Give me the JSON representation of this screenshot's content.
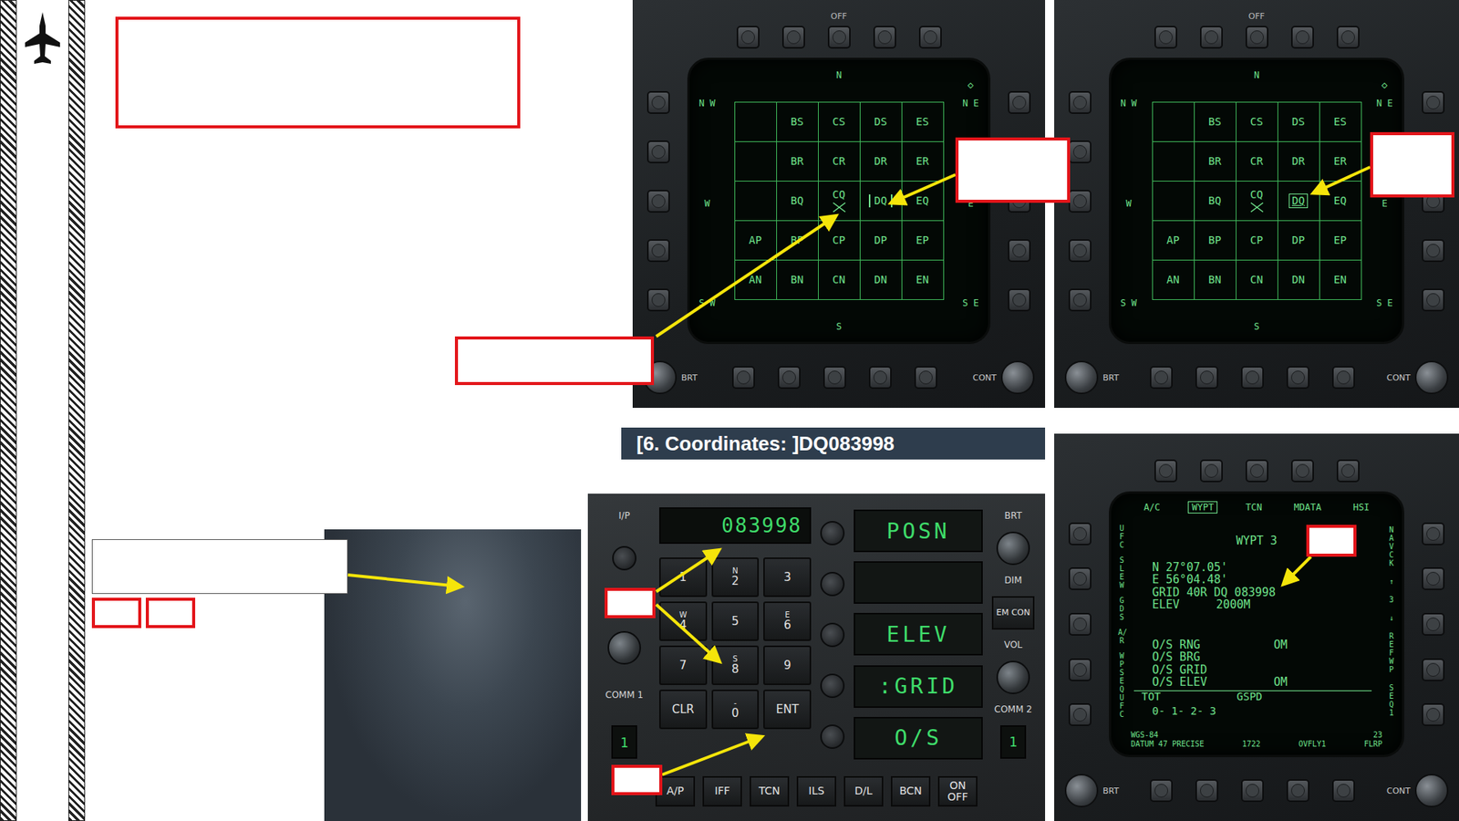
{
  "map_displays": [
    {
      "kind": "bars",
      "top_label": "OFF",
      "knobs": [
        "BRT",
        "CONT"
      ],
      "diamond": "◇",
      "compass": {
        "n": "N",
        "ne": "N E",
        "e": "E",
        "se": "S E",
        "s": "S",
        "sw": "S W",
        "w": "W",
        "nw": "N W"
      },
      "rows": [
        [
          {
            "label": "",
            "selected": false,
            "cursor": false
          },
          {
            "label": "BS",
            "selected": false,
            "cursor": false
          },
          {
            "label": "CS",
            "selected": false,
            "cursor": false
          },
          {
            "label": "DS",
            "selected": false,
            "cursor": false
          },
          {
            "label": "ES",
            "selected": false,
            "cursor": false
          }
        ],
        [
          {
            "label": "",
            "selected": false,
            "cursor": false
          },
          {
            "label": "BR",
            "selected": false,
            "cursor": false
          },
          {
            "label": "CR",
            "selected": false,
            "cursor": false
          },
          {
            "label": "DR",
            "selected": false,
            "cursor": false
          },
          {
            "label": "ER",
            "selected": false,
            "cursor": false
          }
        ],
        [
          {
            "label": "",
            "selected": false,
            "cursor": false
          },
          {
            "label": "BQ",
            "selected": false,
            "cursor": false
          },
          {
            "label": "CQ",
            "selected": false,
            "cursor": true
          },
          {
            "label": "DQ",
            "selected": true,
            "cursor": false
          },
          {
            "label": "EQ",
            "selected": false,
            "cursor": false
          }
        ],
        [
          {
            "label": "AP",
            "selected": false,
            "cursor": false
          },
          {
            "label": "BP",
            "selected": false,
            "cursor": false
          },
          {
            "label": "CP",
            "selected": false,
            "cursor": false
          },
          {
            "label": "DP",
            "selected": false,
            "cursor": false
          },
          {
            "label": "EP",
            "selected": false,
            "cursor": false
          }
        ],
        [
          {
            "label": "AN",
            "selected": false,
            "cursor": false
          },
          {
            "label": "BN",
            "selected": false,
            "cursor": false
          },
          {
            "label": "CN",
            "selected": false,
            "cursor": false
          },
          {
            "label": "DN",
            "selected": false,
            "cursor": false
          },
          {
            "label": "EN",
            "selected": false,
            "cursor": false
          }
        ]
      ]
    },
    {
      "kind": "box",
      "top_label": "OFF",
      "knobs": [
        "BRT",
        "CONT"
      ],
      "diamond": "◇",
      "compass": {
        "n": "N",
        "ne": "N E",
        "e": "E",
        "se": "S E",
        "s": "S",
        "sw": "S W",
        "w": "W",
        "nw": "N W"
      },
      "rows": [
        [
          {
            "label": "",
            "selected": false,
            "cursor": false
          },
          {
            "label": "BS",
            "selected": false,
            "cursor": false
          },
          {
            "label": "CS",
            "selected": false,
            "cursor": false
          },
          {
            "label": "DS",
            "selected": false,
            "cursor": false
          },
          {
            "label": "ES",
            "selected": false,
            "cursor": false
          }
        ],
        [
          {
            "label": "",
            "selected": false,
            "cursor": false
          },
          {
            "label": "BR",
            "selected": false,
            "cursor": false
          },
          {
            "label": "CR",
            "selected": false,
            "cursor": false
          },
          {
            "label": "DR",
            "selected": false,
            "cursor": false
          },
          {
            "label": "ER",
            "selected": false,
            "cursor": false
          }
        ],
        [
          {
            "label": "",
            "selected": false,
            "cursor": false
          },
          {
            "label": "BQ",
            "selected": false,
            "cursor": false
          },
          {
            "label": "CQ",
            "selected": false,
            "cursor": true
          },
          {
            "label": "DQ",
            "selected": true,
            "cursor": false
          },
          {
            "label": "EQ",
            "selected": false,
            "cursor": false
          }
        ],
        [
          {
            "label": "AP",
            "selected": false,
            "cursor": false
          },
          {
            "label": "BP",
            "selected": false,
            "cursor": false
          },
          {
            "label": "CP",
            "selected": false,
            "cursor": false
          },
          {
            "label": "DP",
            "selected": false,
            "cursor": false
          },
          {
            "label": "EP",
            "selected": false,
            "cursor": false
          }
        ],
        [
          {
            "label": "AN",
            "selected": false,
            "cursor": false
          },
          {
            "label": "BN",
            "selected": false,
            "cursor": false
          },
          {
            "label": "CN",
            "selected": false,
            "cursor": false
          },
          {
            "label": "DN",
            "selected": false,
            "cursor": false
          },
          {
            "label": "EN",
            "selected": false,
            "cursor": false
          }
        ]
      ]
    }
  ],
  "caption": "[6. Coordinates: ]DQ083998",
  "ufc": {
    "scratchpad": "083998",
    "keys": [
      {
        "main": "1",
        "sub": ""
      },
      {
        "main": "2",
        "sub": "N"
      },
      {
        "main": "3",
        "sub": ""
      },
      {
        "main": "4",
        "sub": "W"
      },
      {
        "main": "5",
        "sub": ""
      },
      {
        "main": "6",
        "sub": "E"
      },
      {
        "main": "7",
        "sub": ""
      },
      {
        "main": "8",
        "sub": "S"
      },
      {
        "main": "9",
        "sub": ""
      },
      {
        "main": "CLR",
        "sub": ""
      },
      {
        "main": "0",
        "sub": "-"
      },
      {
        "main": "ENT",
        "sub": ""
      }
    ],
    "options": [
      "POSN",
      "",
      "ELEV",
      ":GRID",
      "O/S"
    ],
    "function_keys": [
      "A/P",
      "IFF",
      "TCN",
      "ILS",
      "D/L",
      "BCN",
      "ON OFF"
    ],
    "left": {
      "ip": "I/P",
      "vol": "VOL",
      "comm": "COMM 1",
      "channel": "1"
    },
    "right": {
      "brt": "BRT",
      "dim": "DIM",
      "emcon": "EM CON",
      "vol": "VOL",
      "comm": "COMM 2",
      "channel": "1"
    }
  },
  "waypoint_display": {
    "knobs": [
      "BRT",
      "CONT"
    ],
    "tabs": [
      {
        "label": "A/C",
        "selected": false
      },
      {
        "label": "WYPT",
        "selected": true
      },
      {
        "label": "TCN",
        "selected": false
      },
      {
        "label": "MDATA",
        "selected": false
      },
      {
        "label": "HSI",
        "selected": false
      }
    ],
    "left_options": [
      "UFC",
      "SLEW",
      "GDS",
      "A/R",
      "WP SEQUFC"
    ],
    "right_options": [
      "NAV CK",
      "↑",
      "3",
      "↓",
      "REF WP",
      "SEQ1"
    ],
    "title": "WYPT 3",
    "lat": "N 27°07.05'",
    "lon": "E 56°04.48'",
    "grid": "GRID 40R DQ 083998",
    "elev": "ELEV",
    "elev_value": "2000M",
    "offsets": [
      {
        "label": "O/S RNG",
        "value": "OM"
      },
      {
        "label": "O/S BRG",
        "value": ""
      },
      {
        "label": "O/S GRID",
        "value": ""
      },
      {
        "label": "O/S ELEV",
        "value": "OM"
      }
    ],
    "tot": "TOT",
    "gspd": "GSPD",
    "tot_value": "0- 1- 2- 3",
    "datum": "WGS-84",
    "datum_detail": "DATUM 47 PRECISE",
    "time": "1722",
    "ovfly": "OVFLY1",
    "flrp_number": "23",
    "flrp": "FLRP"
  }
}
